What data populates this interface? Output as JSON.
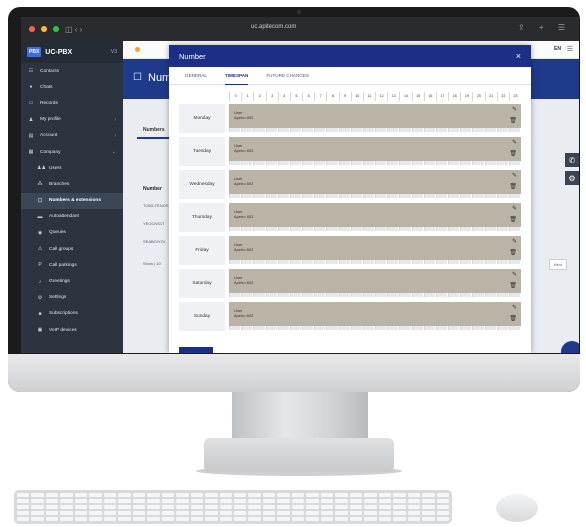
{
  "browser": {
    "url": "uc.apitecom.com",
    "nav_glyphs": "◫ ‹ ›",
    "right_icons": "⇪ + ☰"
  },
  "sidebar": {
    "brand_logo": "PBX",
    "brand_name": "UC-PBX",
    "brand_version": "V3",
    "items": [
      {
        "label": "Contacts",
        "icon": "contacts-icon",
        "glyph": "☷"
      },
      {
        "label": "Chats",
        "icon": "chat-icon",
        "glyph": "●"
      },
      {
        "label": "Records",
        "icon": "records-icon",
        "glyph": "▭"
      },
      {
        "label": "My profile",
        "icon": "user-icon",
        "glyph": "♟",
        "chevron": "›"
      },
      {
        "label": "Account",
        "icon": "account-icon",
        "glyph": "▤",
        "chevron": "›"
      },
      {
        "label": "Company",
        "icon": "company-icon",
        "glyph": "▦",
        "chevron": "⌄"
      },
      {
        "label": "Users",
        "icon": "users-icon",
        "glyph": "♟♟",
        "sub": true
      },
      {
        "label": "Branches",
        "icon": "branches-icon",
        "glyph": "⁂",
        "sub": true
      },
      {
        "label": "Numbers & extensions",
        "icon": "phone-icon",
        "glyph": "☐",
        "sub": true,
        "active": true
      },
      {
        "label": "Autoattendant",
        "icon": "autoattendant-icon",
        "glyph": "▬",
        "sub": true
      },
      {
        "label": "Queues",
        "icon": "queues-icon",
        "glyph": "◉",
        "sub": true
      },
      {
        "label": "Call groups",
        "icon": "call-groups-icon",
        "glyph": "⚠",
        "sub": true
      },
      {
        "label": "Call parkings",
        "icon": "parking-icon",
        "glyph": "P",
        "sub": true
      },
      {
        "label": "Greetings",
        "icon": "greetings-icon",
        "glyph": "♪",
        "sub": true
      },
      {
        "label": "Settings",
        "icon": "settings-icon",
        "glyph": "⚙",
        "sub": true
      },
      {
        "label": "Subscriptions",
        "icon": "subscriptions-icon",
        "glyph": "■",
        "sub": true
      },
      {
        "label": "VoIP devices",
        "icon": "voip-icon",
        "glyph": "▣",
        "sub": true
      }
    ]
  },
  "main": {
    "lang": "EN",
    "title": "Numb",
    "tab": "Numbers",
    "column_header": "Number",
    "rows": [
      "TOMCTENOS",
      "YEOCNS1T",
      "SEABOIYOI"
    ],
    "show": "Show | 10",
    "next": "Next"
  },
  "modal": {
    "title": "Number",
    "close": "×",
    "tabs": [
      "GENERAL",
      "TIMESPAN",
      "FUTURE CHANGES"
    ],
    "active_tab": 1,
    "hours": [
      "0",
      "1",
      "2",
      "3",
      "4",
      "5",
      "6",
      "7",
      "8",
      "9",
      "10",
      "11",
      "12",
      "13",
      "14",
      "15",
      "16",
      "17",
      "18",
      "19",
      "20",
      "21",
      "22",
      "23"
    ],
    "days": [
      {
        "day": "Monday",
        "line1": "User",
        "line2": "Apeiro 802"
      },
      {
        "day": "Tuesday",
        "line1": "User",
        "line2": "Apeiro 802"
      },
      {
        "day": "Wednesday",
        "line1": "User",
        "line2": "Apeiro 802"
      },
      {
        "day": "Thursday",
        "line1": "User",
        "line2": "Apeiro 802"
      },
      {
        "day": "Friday",
        "line1": "User",
        "line2": "Apeiro 802"
      },
      {
        "day": "Saturday",
        "line1": "User",
        "line2": "Apeiro 802"
      },
      {
        "day": "Sunday",
        "line1": "User",
        "line2": "Apeiro 802"
      }
    ]
  },
  "colors": {
    "accent": "#1c2f86",
    "sidebar_bg": "#2c3440",
    "slot_fill": "#b9b4a5"
  }
}
